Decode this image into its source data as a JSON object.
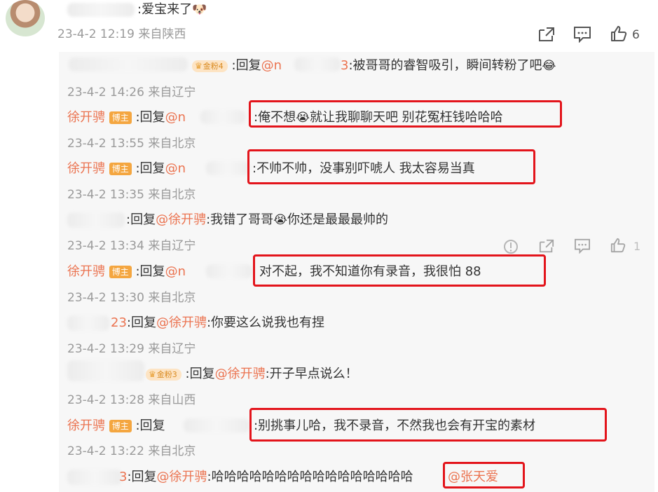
{
  "main_comment": {
    "text": ":爱宝来了",
    "meta": "23-4-2 12:19 来自陕西",
    "like_count": "6"
  },
  "replies": [
    {
      "badge": "金粉4",
      "reply_prefix": ":回复",
      "target": "@n",
      "target_tail": "3",
      "content": ":被哥哥的睿智吸引，瞬间转粉了吧",
      "meta": "23-4-2 14:26 来自辽宁"
    },
    {
      "user": "徐开骋",
      "role": "博主",
      "reply_prefix": ":回复",
      "target": "@n",
      "target_tail": "3",
      "content": ":俺不想",
      "content2": "就让我聊聊天吧 别花冤枉钱哈哈哈",
      "meta": "23-4-2 13:55 来自北京"
    },
    {
      "user": "徐开骋",
      "role": "博主",
      "reply_prefix": ":回复",
      "target": "@n",
      "content": ":不帅不帅，没事别吓唬人 我太容易当真",
      "meta": "23-4-2 13:35 来自北京"
    },
    {
      "reply_prefix": ":回复",
      "target": "@徐开骋",
      "content": ":我错了哥哥",
      "content2": "你还是最最最帅的",
      "meta": "23-4-2 13:34 来自辽宁",
      "like_count": "1"
    },
    {
      "user": "徐开骋",
      "role": "博主",
      "reply_prefix": ":回复",
      "target": "@n",
      "content": "对不起，我不知道你有录音，我很怕 88",
      "meta": "23-4-2 13:30 来自北京"
    },
    {
      "user_tail": "23",
      "reply_prefix": ":回复",
      "target": "@徐开骋",
      "content": ":你要这么说我也有捏",
      "meta": "23-4-2 13:29 来自辽宁"
    },
    {
      "badge": "金粉3",
      "reply_prefix": ":回复",
      "target": "@徐开骋",
      "content": ":开子早点说么！",
      "meta": "23-4-2 13:28 来自山西"
    },
    {
      "user": "徐开骋",
      "role": "博主",
      "reply_prefix": ":回复",
      "content": ":别挑事儿哈，我不录音，不然我也会有开宝的素材",
      "meta": "23-4-2 13:22 来自北京"
    },
    {
      "user_tail": "3",
      "reply_prefix": ":回复",
      "target": "@徐开骋",
      "content": ":哈哈哈哈哈哈哈哈哈哈哈哈哈哈哈哈",
      "mention": "@张天爱"
    }
  ],
  "icons": {
    "share": "share-icon",
    "comment": "comment-icon",
    "like": "thumbs-up-icon",
    "report": "report-icon"
  },
  "colors": {
    "highlight_box": "#e3141b",
    "username": "#eb7350",
    "meta": "#9a9a9a",
    "blogger_tag": "#f4a640"
  }
}
